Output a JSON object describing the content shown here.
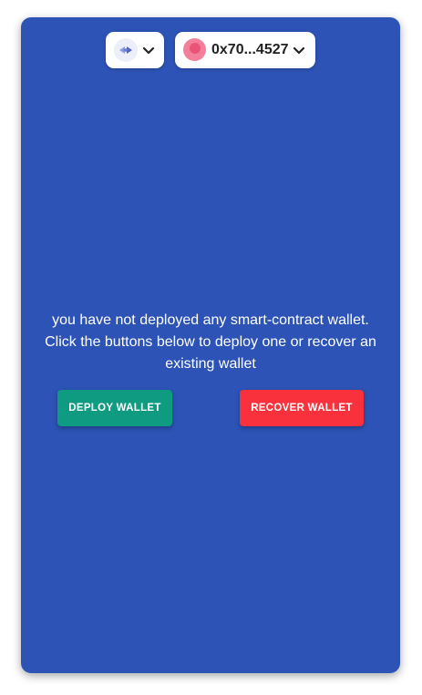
{
  "header": {
    "network": {
      "icon": "ethereum-icon",
      "dropdown_icon": "chevron-down-icon"
    },
    "account": {
      "address": "0x70...4527",
      "avatar_color": "#f47f9a",
      "dropdown_icon": "chevron-down-icon"
    }
  },
  "main": {
    "message": "you have not deployed any smart-contract wallet. Click the buttons below to deploy one or recover an existing wallet",
    "deploy_button": "DEPLOY WALLET",
    "recover_button": "RECOVER WALLET"
  },
  "colors": {
    "card_background": "#2c53b5",
    "deploy_button": "#0e9b82",
    "recover_button": "#f9313c"
  }
}
